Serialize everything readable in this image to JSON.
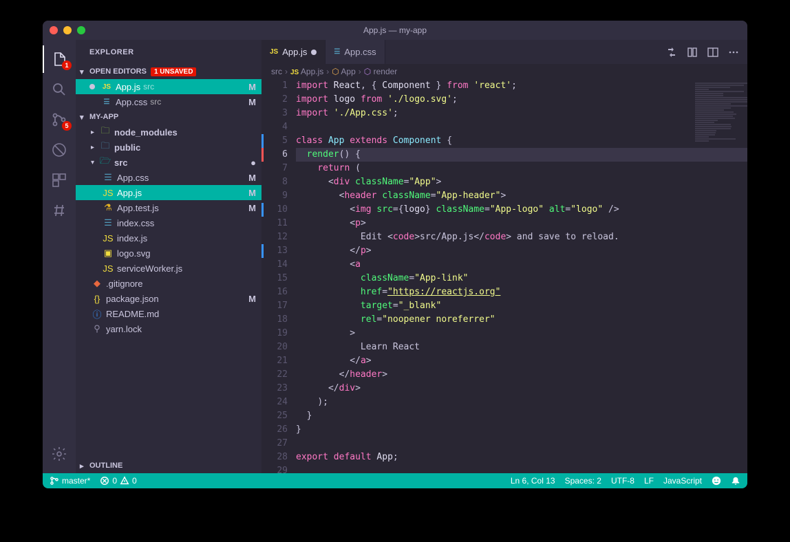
{
  "window": {
    "title": "App.js — my-app"
  },
  "explorer": {
    "title": "EXPLORER",
    "open_editors_label": "OPEN EDITORS",
    "unsaved_badge": "1 UNSAVED",
    "project_label": "MY-APP",
    "outline_label": "OUTLINE",
    "open_editors": [
      {
        "name": "App.js",
        "path": "src",
        "modified": true,
        "status": "M",
        "active": true,
        "icon": "js"
      },
      {
        "name": "App.css",
        "path": "src",
        "modified": false,
        "status": "M",
        "active": false,
        "icon": "css"
      }
    ],
    "tree": [
      {
        "type": "folder",
        "name": "node_modules",
        "indent": 1,
        "expanded": false,
        "icon": "folder-green"
      },
      {
        "type": "folder",
        "name": "public",
        "indent": 1,
        "expanded": false,
        "icon": "folder-blue"
      },
      {
        "type": "folder",
        "name": "src",
        "indent": 1,
        "expanded": true,
        "icon": "folder",
        "status": "●"
      },
      {
        "type": "file",
        "name": "App.css",
        "indent": 2,
        "icon": "css",
        "status": "M"
      },
      {
        "type": "file",
        "name": "App.js",
        "indent": 2,
        "icon": "js",
        "status": "M",
        "active": true
      },
      {
        "type": "file",
        "name": "App.test.js",
        "indent": 2,
        "icon": "test",
        "status": "M"
      },
      {
        "type": "file",
        "name": "index.css",
        "indent": 2,
        "icon": "css"
      },
      {
        "type": "file",
        "name": "index.js",
        "indent": 2,
        "icon": "js"
      },
      {
        "type": "file",
        "name": "logo.svg",
        "indent": 2,
        "icon": "svg"
      },
      {
        "type": "file",
        "name": "serviceWorker.js",
        "indent": 2,
        "icon": "js"
      },
      {
        "type": "file",
        "name": ".gitignore",
        "indent": 1,
        "icon": "git"
      },
      {
        "type": "file",
        "name": "package.json",
        "indent": 1,
        "icon": "json",
        "status": "M"
      },
      {
        "type": "file",
        "name": "README.md",
        "indent": 1,
        "icon": "info"
      },
      {
        "type": "file",
        "name": "yarn.lock",
        "indent": 1,
        "icon": "lock"
      }
    ]
  },
  "tabs": [
    {
      "label": "App.js",
      "icon": "js",
      "modified": true,
      "active": true
    },
    {
      "label": "App.css",
      "icon": "css",
      "modified": false,
      "active": false
    }
  ],
  "breadcrumbs": [
    "src",
    "App.js",
    "App",
    "render"
  ],
  "activity_badges": {
    "explorer": "1",
    "scm": "5"
  },
  "code_lines": [
    {
      "n": 1,
      "html": "<span class='kw'>import</span> <span class='var'>React</span><span class='punc'>, { </span><span class='var'>Component</span><span class='punc'> } </span><span class='kw'>from</span> <span class='str'>'react'</span><span class='punc'>;</span>"
    },
    {
      "n": 2,
      "html": "<span class='kw'>import</span> <span class='var'>logo</span> <span class='kw'>from</span> <span class='str'>'./logo.svg'</span><span class='punc'>;</span>"
    },
    {
      "n": 3,
      "html": "<span class='kw'>import</span> <span class='str'>'./App.css'</span><span class='punc'>;</span>"
    },
    {
      "n": 4,
      "html": ""
    },
    {
      "n": 5,
      "bar": "blue",
      "html": "<span class='kw'>class</span> <span class='cls'>App</span> <span class='kw'>extends</span> <span class='cls'>Component</span> <span class='punc'>{</span>"
    },
    {
      "n": 6,
      "bar": "red",
      "cur": true,
      "html": "  <span class='fn'>render</span><span class='punc'>() {</span>"
    },
    {
      "n": 7,
      "html": "    <span class='kw'>return</span> <span class='punc'>(</span>"
    },
    {
      "n": 8,
      "html": "      <span class='punc'>&lt;</span><span class='tag'>div</span> <span class='attr'>className</span><span class='punc'>=</span><span class='str'>\"App\"</span><span class='punc'>&gt;</span>"
    },
    {
      "n": 9,
      "html": "        <span class='punc'>&lt;</span><span class='tag'>header</span> <span class='attr'>className</span><span class='punc'>=</span><span class='str'>\"App-header\"</span><span class='punc'>&gt;</span>"
    },
    {
      "n": 10,
      "bar": "blue",
      "html": "          <span class='punc'>&lt;</span><span class='tag'>img</span> <span class='attr'>src</span><span class='punc'>={</span><span class='var'>logo</span><span class='punc'>}</span> <span class='attr'>className</span><span class='punc'>=</span><span class='str'>\"App-logo\"</span> <span class='attr'>alt</span><span class='punc'>=</span><span class='str'>\"logo\"</span> <span class='punc'>/&gt;</span>"
    },
    {
      "n": 11,
      "html": "          <span class='punc'>&lt;</span><span class='tag'>p</span><span class='punc'>&gt;</span>"
    },
    {
      "n": 12,
      "html": "            Edit <span class='punc'>&lt;</span><span class='tag'>code</span><span class='punc'>&gt;</span>src/App.js<span class='punc'>&lt;/</span><span class='tag'>code</span><span class='punc'>&gt;</span> and save to reload."
    },
    {
      "n": 13,
      "bar": "blue",
      "html": "          <span class='punc'>&lt;/</span><span class='tag'>p</span><span class='punc'>&gt;</span>"
    },
    {
      "n": 14,
      "html": "          <span class='punc'>&lt;</span><span class='tag'>a</span>"
    },
    {
      "n": 15,
      "html": "            <span class='attr'>className</span><span class='punc'>=</span><span class='str'>\"App-link\"</span>"
    },
    {
      "n": 16,
      "html": "            <span class='attr'>href</span><span class='punc'>=</span><span class='str url'>\"https://reactjs.org\"</span>"
    },
    {
      "n": 17,
      "html": "            <span class='attr'>target</span><span class='punc'>=</span><span class='str'>\"_blank\"</span>"
    },
    {
      "n": 18,
      "html": "            <span class='attr'>rel</span><span class='punc'>=</span><span class='str'>\"noopener noreferrer\"</span>"
    },
    {
      "n": 19,
      "html": "          <span class='punc'>&gt;</span>"
    },
    {
      "n": 20,
      "html": "            Learn React"
    },
    {
      "n": 21,
      "html": "          <span class='punc'>&lt;/</span><span class='tag'>a</span><span class='punc'>&gt;</span>"
    },
    {
      "n": 22,
      "html": "        <span class='punc'>&lt;/</span><span class='tag'>header</span><span class='punc'>&gt;</span>"
    },
    {
      "n": 23,
      "html": "      <span class='punc'>&lt;/</span><span class='tag'>div</span><span class='punc'>&gt;</span>"
    },
    {
      "n": 24,
      "html": "    <span class='punc'>);</span>"
    },
    {
      "n": 25,
      "html": "  <span class='punc'>}</span>"
    },
    {
      "n": 26,
      "html": "<span class='punc'>}</span>"
    },
    {
      "n": 27,
      "html": ""
    },
    {
      "n": 28,
      "html": "<span class='kw'>export</span> <span class='kw'>default</span> <span class='var'>App</span><span class='punc'>;</span>"
    },
    {
      "n": 29,
      "html": ""
    }
  ],
  "statusbar": {
    "branch": "master*",
    "errors": "0",
    "warnings": "0",
    "cursor": "Ln 6, Col 13",
    "spaces": "Spaces: 2",
    "encoding": "UTF-8",
    "eol": "LF",
    "language": "JavaScript"
  }
}
